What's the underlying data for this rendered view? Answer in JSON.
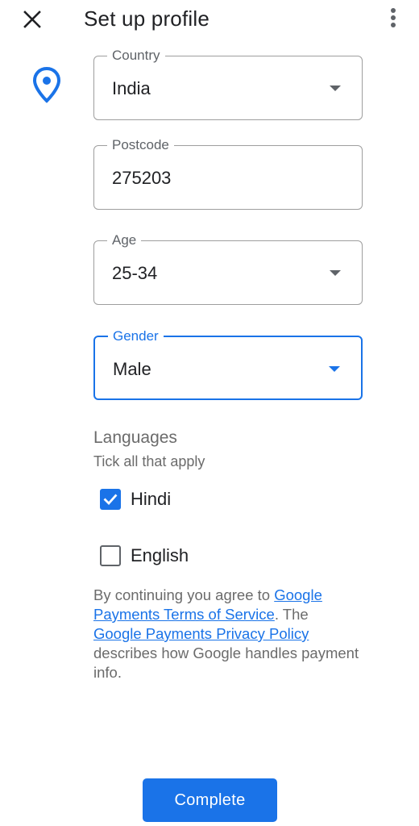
{
  "header": {
    "title": "Set up profile",
    "close_icon": "close-icon",
    "more_icon": "more-vert-icon"
  },
  "form": {
    "country": {
      "label": "Country",
      "value": "India"
    },
    "postcode": {
      "label": "Postcode",
      "value": "275203"
    },
    "age": {
      "label": "Age",
      "value": "25-34"
    },
    "gender": {
      "label": "Gender",
      "value": "Male",
      "focused": true
    }
  },
  "languages": {
    "heading": "Languages",
    "subheading": "Tick all that apply",
    "options": [
      {
        "label": "Hindi",
        "checked": true
      },
      {
        "label": "English",
        "checked": false
      }
    ]
  },
  "legal": {
    "prefix": "By continuing you agree to ",
    "tos_link": "Google Payments Terms of Service",
    "middle": ". The ",
    "privacy_link": "Google Payments Privacy Policy",
    "suffix": " describes how Google handles payment info."
  },
  "actions": {
    "complete_label": "Complete"
  },
  "colors": {
    "accent": "#1a73e8",
    "border": "#9e9e9e",
    "secondary_text": "#6b6b6b"
  }
}
